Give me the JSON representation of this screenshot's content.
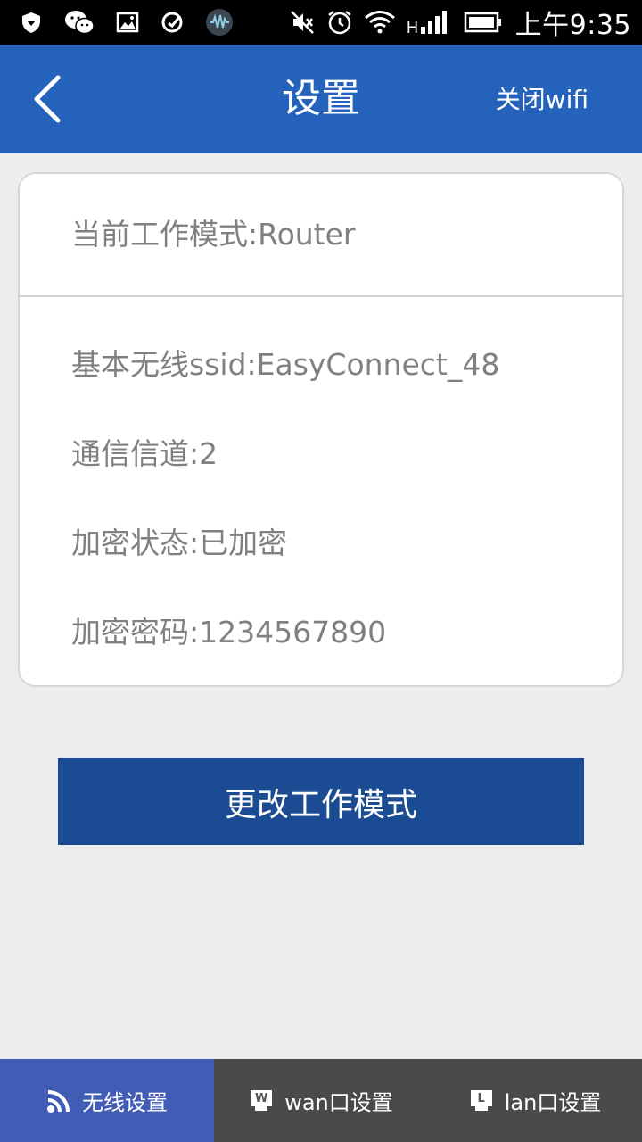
{
  "status_bar": {
    "time": "上午9:35",
    "icons_left": [
      "shield-icon",
      "wechat-icon",
      "image-icon",
      "check-circle-icon",
      "audio-app-icon"
    ],
    "icons_right": [
      "mute-icon",
      "alarm-icon",
      "wifi-icon",
      "signal-icon",
      "battery-icon"
    ],
    "network_type": "H"
  },
  "header": {
    "title": "设置",
    "right_action": "关闭wifi",
    "color": "#2462bb"
  },
  "card": {
    "mode": "当前工作模式:Router",
    "ssid": "基本无线ssid:EasyConnect_48",
    "channel": "通信信道:2",
    "encryption_status": "加密状态:已加密",
    "password": "加密密码:1234567890"
  },
  "main_button": {
    "label": "更改工作模式",
    "color": "#1a4b93"
  },
  "tabs": [
    {
      "label": "无线设置",
      "icon": "wireless-icon",
      "active": true
    },
    {
      "label": "wan口设置",
      "icon": "wan-port-icon",
      "badge": "W",
      "active": false
    },
    {
      "label": "lan口设置",
      "icon": "lan-port-icon",
      "badge": "L",
      "active": false
    }
  ]
}
